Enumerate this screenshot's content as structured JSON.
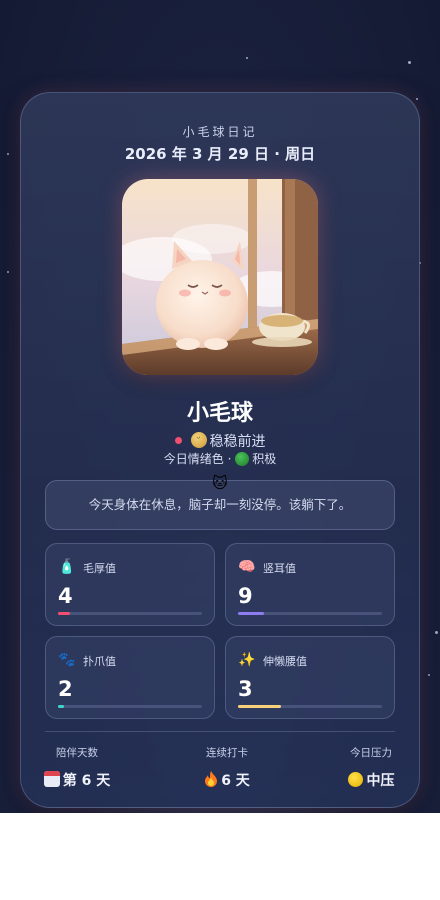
{
  "header": {
    "app_title": "小毛球日记",
    "date": "2026 年 3 月 29 日 · 周日"
  },
  "pet": {
    "name": "小毛球",
    "status": "稳稳前进",
    "mood_label": "今日情绪色",
    "mood_value": "积极",
    "mood_color": "#2fa53d",
    "status_dot_color": "#f0506e"
  },
  "quote": "今天身体在休息，脑子却一刻没停。该躺下了。",
  "stats": [
    {
      "icon": "bottle-icon",
      "label": "毛厚值",
      "value": "4",
      "progress": 0.08,
      "color": "#f0506e"
    },
    {
      "icon": "brain-icon",
      "label": "竖耳值",
      "value": "9",
      "progress": 0.18,
      "color": "#8e7cf0"
    },
    {
      "icon": "paw-icon",
      "label": "扑爪值",
      "value": "2",
      "progress": 0.04,
      "color": "#3fd6c6"
    },
    {
      "icon": "sparkles-icon",
      "label": "伸懒腰值",
      "value": "3",
      "progress": 0.3,
      "color": "#f5d27a"
    }
  ],
  "footer": {
    "days_label": "陪伴天数",
    "days_value": "第 6 天",
    "streak_label": "连续打卡",
    "streak_value": "6 天",
    "stress_label": "今日压力",
    "stress_value": "中压"
  }
}
